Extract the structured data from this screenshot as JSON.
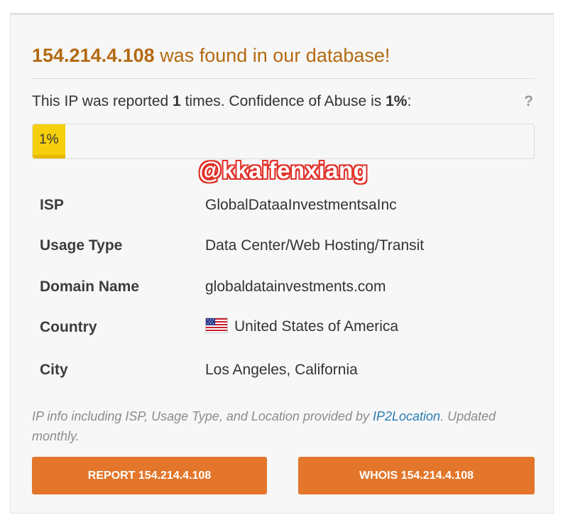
{
  "header": {
    "ip": "154.214.4.108",
    "found_text": "was found in our database!"
  },
  "report": {
    "prefix": "This IP was reported",
    "count": "1",
    "middle": "times. Confidence of Abuse is",
    "confidence": "1%",
    "suffix": ":",
    "help_symbol": "?"
  },
  "progress": {
    "label": "1%",
    "value_percent": 1
  },
  "watermark": "@kkaifenxiang",
  "details": [
    {
      "label": "ISP",
      "value": "GlobalDataaInvestmentsaInc"
    },
    {
      "label": "Usage Type",
      "value": "Data Center/Web Hosting/Transit"
    },
    {
      "label": "Domain Name",
      "value": "globaldatainvestments.com"
    },
    {
      "label": "Country",
      "value": "United States of America",
      "icon": "us-flag-icon"
    },
    {
      "label": "City",
      "value": "Los Angeles, California"
    }
  ],
  "note": {
    "before_link": "IP info including ISP, Usage Type, and Location provided by",
    "link_text": "IP2Location",
    "after_link": ". Updated monthly."
  },
  "buttons": {
    "report_label": "REPORT 154.214.4.108",
    "whois_label": "WHOIS 154.214.4.108"
  },
  "colors": {
    "title": "#b36a12",
    "accent_button": "#e3762a",
    "progress_fill": "#f5cf0b",
    "link": "#2a7db5",
    "watermark_outline": "#e0322a"
  }
}
